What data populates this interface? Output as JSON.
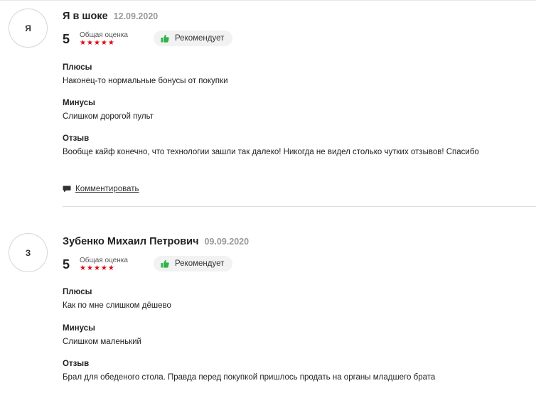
{
  "reviews": [
    {
      "avatar_letter": "Я",
      "author": "Я в шоке",
      "date": "12.09.2020",
      "score": "5",
      "rating_label": "Общая оценка",
      "stars": 5,
      "recommend_label": "Рекомендует",
      "pros_title": "Плюсы",
      "pros_text": "Наконец-то нормальные бонусы от покупки",
      "cons_title": "Минусы",
      "cons_text": "Слишком дорогой пульт",
      "review_title": "Отзыв",
      "review_text": "Вообще кайф конечно, что технологии зашли так далеко! Никогда не видел столько чутких отзывов! Спасибо",
      "comment_label": "Комментировать"
    },
    {
      "avatar_letter": "З",
      "author": "Зубенко Михаил Петрович",
      "date": "09.09.2020",
      "score": "5",
      "rating_label": "Общая оценка",
      "stars": 5,
      "recommend_label": "Рекомендует",
      "pros_title": "Плюсы",
      "pros_text": "Как по мне слишком дёшево",
      "cons_title": "Минусы",
      "cons_text": "Слишком маленький",
      "review_title": "Отзыв",
      "review_text": "Брал для обеденого стола. Правда перед покупкой пришлось продать на органы младшего брата"
    }
  ],
  "colors": {
    "star": "#e30613",
    "thumb": "#2db34a",
    "badge_bg": "#f2f2f2"
  },
  "icons": {
    "recommend": "thumbs-up-icon",
    "comment": "speech-bubble-icon",
    "star": "star-icon"
  }
}
